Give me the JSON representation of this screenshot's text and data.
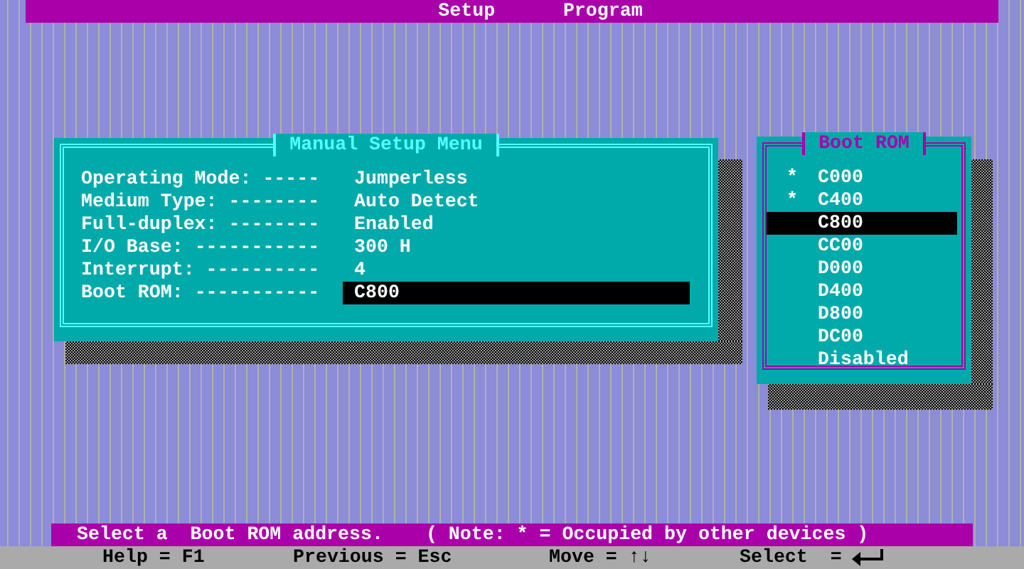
{
  "title_bar": {
    "title": "Setup      Program"
  },
  "manual_menu": {
    "title": "Manual Setup Menu",
    "fields": [
      {
        "label": "Operating Mode:",
        "leader": "-----",
        "value": "Jumperless",
        "selected": false
      },
      {
        "label": "Medium Type:",
        "leader": "--------",
        "value": "Auto Detect",
        "selected": false
      },
      {
        "label": "Full-duplex:",
        "leader": "--------",
        "value": "Enabled",
        "selected": false
      },
      {
        "label": "I/O Base:",
        "leader": "-----------",
        "value": "300 H",
        "selected": false
      },
      {
        "label": "Interrupt:",
        "leader": "----------",
        "value": "4",
        "selected": false
      },
      {
        "label": "Boot ROM:",
        "leader": "-----------",
        "value": "C800",
        "selected": true
      }
    ]
  },
  "boot_rom_menu": {
    "title": "Boot ROM",
    "options": [
      {
        "label": "C000",
        "marker": "*",
        "selected": false
      },
      {
        "label": "C400",
        "marker": "*",
        "selected": false
      },
      {
        "label": "C800",
        "selected": true
      },
      {
        "label": "CC00",
        "selected": false
      },
      {
        "label": "D000",
        "selected": false
      },
      {
        "label": "D400",
        "selected": false
      },
      {
        "label": "D800",
        "selected": false
      },
      {
        "label": "DC00",
        "selected": false
      },
      {
        "label": "Disabled",
        "selected": false
      }
    ]
  },
  "status_line": {
    "message": "Select a  Boot ROM address.",
    "note": "( Note: * = Occupied by other devices )"
  },
  "key_hints": [
    {
      "kind": "text",
      "label": "Help = F1"
    },
    {
      "kind": "text",
      "label": "Previous = Esc"
    },
    {
      "kind": "text",
      "label": "Move = ↑↓"
    },
    {
      "kind": "enter",
      "label": "Select  ="
    }
  ]
}
